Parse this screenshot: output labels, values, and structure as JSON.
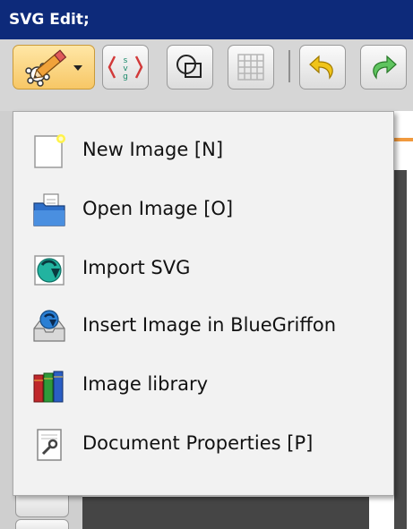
{
  "window": {
    "title": "SVG Edit;"
  },
  "toolbar": {
    "buttons": [
      {
        "icon": "pencil-brush-icon",
        "active": true
      },
      {
        "icon": "svg-source-icon"
      },
      {
        "icon": "wireframe-shapes-icon"
      },
      {
        "icon": "grid-icon"
      },
      {
        "icon": "undo-icon"
      },
      {
        "icon": "redo-icon"
      }
    ]
  },
  "menu": {
    "items": [
      {
        "label": "New Image [N]",
        "icon": "new-image-icon"
      },
      {
        "label": "Open Image [O]",
        "icon": "folder-open-icon"
      },
      {
        "label": "Import SVG",
        "icon": "import-svg-icon"
      },
      {
        "label": "Insert Image in BlueGriffon",
        "icon": "insert-image-icon"
      },
      {
        "label": "Image library",
        "icon": "books-library-icon"
      },
      {
        "label": "Document Properties [P]",
        "icon": "document-properties-icon"
      }
    ]
  },
  "colors": {
    "titlebar": "#0d2a7a",
    "toolbar": "#d6d6d6",
    "menu_background": "#f2f2f2",
    "active_button": "#f7c766",
    "accent_orange": "#f19a3e"
  }
}
